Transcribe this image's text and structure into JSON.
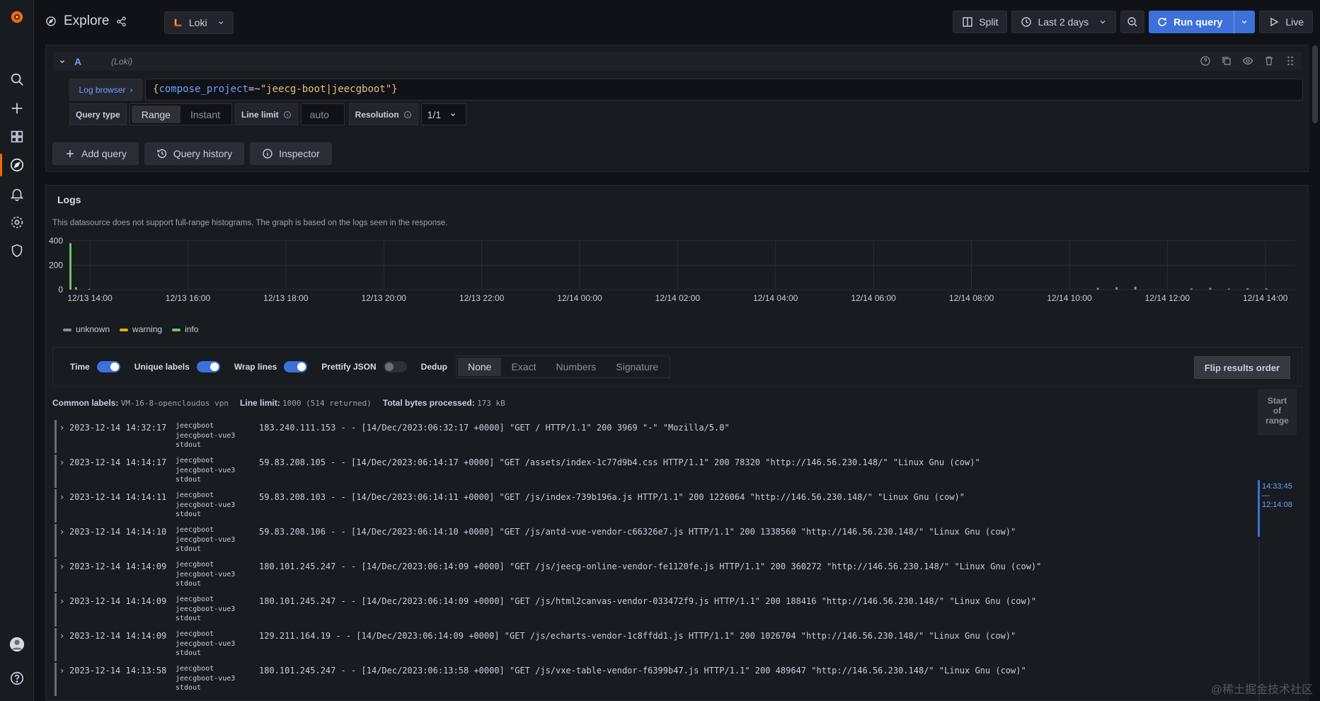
{
  "app": {
    "title": "Explore"
  },
  "datasource": {
    "name": "Loki"
  },
  "toolbar": {
    "split": "Split",
    "time_range": "Last 2 days",
    "run_query": "Run query",
    "live": "Live"
  },
  "query": {
    "letter": "A",
    "ds_label": "(Loki)",
    "log_browser": "Log browser",
    "expr_selector": "compose_project",
    "expr_op": "=~",
    "expr_value": "\"jeecg-boot|jeecgboot\"",
    "query_type_label": "Query type",
    "query_type_options": [
      "Range",
      "Instant"
    ],
    "line_limit_label": "Line limit",
    "line_limit_placeholder": "auto",
    "resolution_label": "Resolution",
    "resolution_value": "1/1",
    "add_query": "Add query",
    "query_history": "Query history",
    "inspector": "Inspector"
  },
  "logs": {
    "title": "Logs",
    "notice": "This datasource does not support full-range histograms. The graph is based on the logs seen in the response.",
    "legend": [
      {
        "name": "unknown",
        "color": "#8e8e8e"
      },
      {
        "name": "warning",
        "color": "#e0b400"
      },
      {
        "name": "info",
        "color": "#73bf69"
      }
    ],
    "controls": {
      "time": "Time",
      "unique_labels": "Unique labels",
      "wrap_lines": "Wrap lines",
      "prettify_json": "Prettify JSON",
      "dedup": "Dedup",
      "dedup_options": [
        "None",
        "Exact",
        "Numbers",
        "Signature"
      ],
      "flip": "Flip results order"
    },
    "common_labels_label": "Common labels:",
    "common_labels_value": "VM-16-8-opencloudos vpn",
    "line_limit_label": "Line limit:",
    "line_limit_value": "1000 (514 returned)",
    "bytes_label": "Total bytes processed:",
    "bytes_value": "173 kB",
    "range_start": "Start of range",
    "range_top": "14:33:45",
    "range_sep": "—",
    "range_bottom": "12:14:08",
    "rows": [
      {
        "ts": "2023-12-14 14:32:17",
        "l1": "jeecgboot",
        "l2": "jeecgboot-vue3",
        "l3": "stdout",
        "line": "183.240.111.153 - - [14/Dec/2023:06:32:17 +0000] \"GET / HTTP/1.1\" 200 3969 \"-\" \"Mozilla/5.0\""
      },
      {
        "ts": "2023-12-14 14:14:17",
        "l1": "jeecgboot",
        "l2": "jeecgboot-vue3",
        "l3": "stdout",
        "line": "59.83.208.105 - - [14/Dec/2023:06:14:17 +0000] \"GET /assets/index-1c77d9b4.css HTTP/1.1\" 200 78320 \"http://146.56.230.148/\" \"Linux Gnu (cow)\""
      },
      {
        "ts": "2023-12-14 14:14:11",
        "l1": "jeecgboot",
        "l2": "jeecgboot-vue3",
        "l3": "stdout",
        "line": "59.83.208.103 - - [14/Dec/2023:06:14:11 +0000] \"GET /js/index-739b196a.js HTTP/1.1\" 200 1226064 \"http://146.56.230.148/\" \"Linux Gnu (cow)\""
      },
      {
        "ts": "2023-12-14 14:14:10",
        "l1": "jeecgboot",
        "l2": "jeecgboot-vue3",
        "l3": "stdout",
        "line": "59.83.208.106 - - [14/Dec/2023:06:14:10 +0000] \"GET /js/antd-vue-vendor-c66326e7.js HTTP/1.1\" 200 1338560 \"http://146.56.230.148/\" \"Linux Gnu (cow)\""
      },
      {
        "ts": "2023-12-14 14:14:09",
        "l1": "jeecgboot",
        "l2": "jeecgboot-vue3",
        "l3": "stdout",
        "line": "180.101.245.247 - - [14/Dec/2023:06:14:09 +0000] \"GET /js/jeecg-online-vendor-fe1120fe.js HTTP/1.1\" 200 360272 \"http://146.56.230.148/\" \"Linux Gnu (cow)\""
      },
      {
        "ts": "2023-12-14 14:14:09",
        "l1": "jeecgboot",
        "l2": "jeecgboot-vue3",
        "l3": "stdout",
        "line": "180.101.245.247 - - [14/Dec/2023:06:14:09 +0000] \"GET /js/html2canvas-vendor-033472f9.js HTTP/1.1\" 200 188416 \"http://146.56.230.148/\" \"Linux Gnu (cow)\""
      },
      {
        "ts": "2023-12-14 14:14:09",
        "l1": "jeecgboot",
        "l2": "jeecgboot-vue3",
        "l3": "stdout",
        "line": "129.211.164.19 - - [14/Dec/2023:06:14:09 +0000] \"GET /js/echarts-vendor-1c8ffdd1.js HTTP/1.1\" 200 1026704 \"http://146.56.230.148/\" \"Linux Gnu (cow)\""
      },
      {
        "ts": "2023-12-14 14:13:58",
        "l1": "jeecgboot",
        "l2": "jeecgboot-vue3",
        "l3": "stdout",
        "line": "180.101.245.247 - - [14/Dec/2023:06:13:58 +0000] \"GET /js/vxe-table-vendor-f6399b47.js HTTP/1.1\" 200 489647 \"http://146.56.230.148/\" \"Linux Gnu (cow)\""
      }
    ]
  },
  "chart_data": {
    "type": "bar",
    "yticks": [
      0,
      200,
      400
    ],
    "ylim": [
      0,
      400
    ],
    "xticks": [
      "12/13 14:00",
      "12/13 16:00",
      "12/13 18:00",
      "12/13 20:00",
      "12/13 22:00",
      "12/14 00:00",
      "12/14 02:00",
      "12/14 04:00",
      "12/14 06:00",
      "12/14 08:00",
      "12/14 10:00",
      "12/14 12:00",
      "12/14 14:00"
    ],
    "series": [
      {
        "name": "info",
        "color": "#73bf69",
        "points": [
          [
            0.0,
            380
          ],
          [
            0.3,
            20
          ]
        ]
      },
      {
        "name": "unknown",
        "color": "#8e8e8e",
        "points": [
          [
            1.0,
            6
          ],
          [
            54.9,
            14
          ],
          [
            55.9,
            20
          ],
          [
            56.9,
            24
          ],
          [
            59.9,
            10
          ],
          [
            60.9,
            14
          ],
          [
            61.9,
            8
          ],
          [
            62.9,
            12
          ],
          [
            63.9,
            10
          ]
        ]
      }
    ],
    "x_range_hours": [
      0,
      65.5
    ],
    "watermark": "@稀土掘金技术社区"
  }
}
